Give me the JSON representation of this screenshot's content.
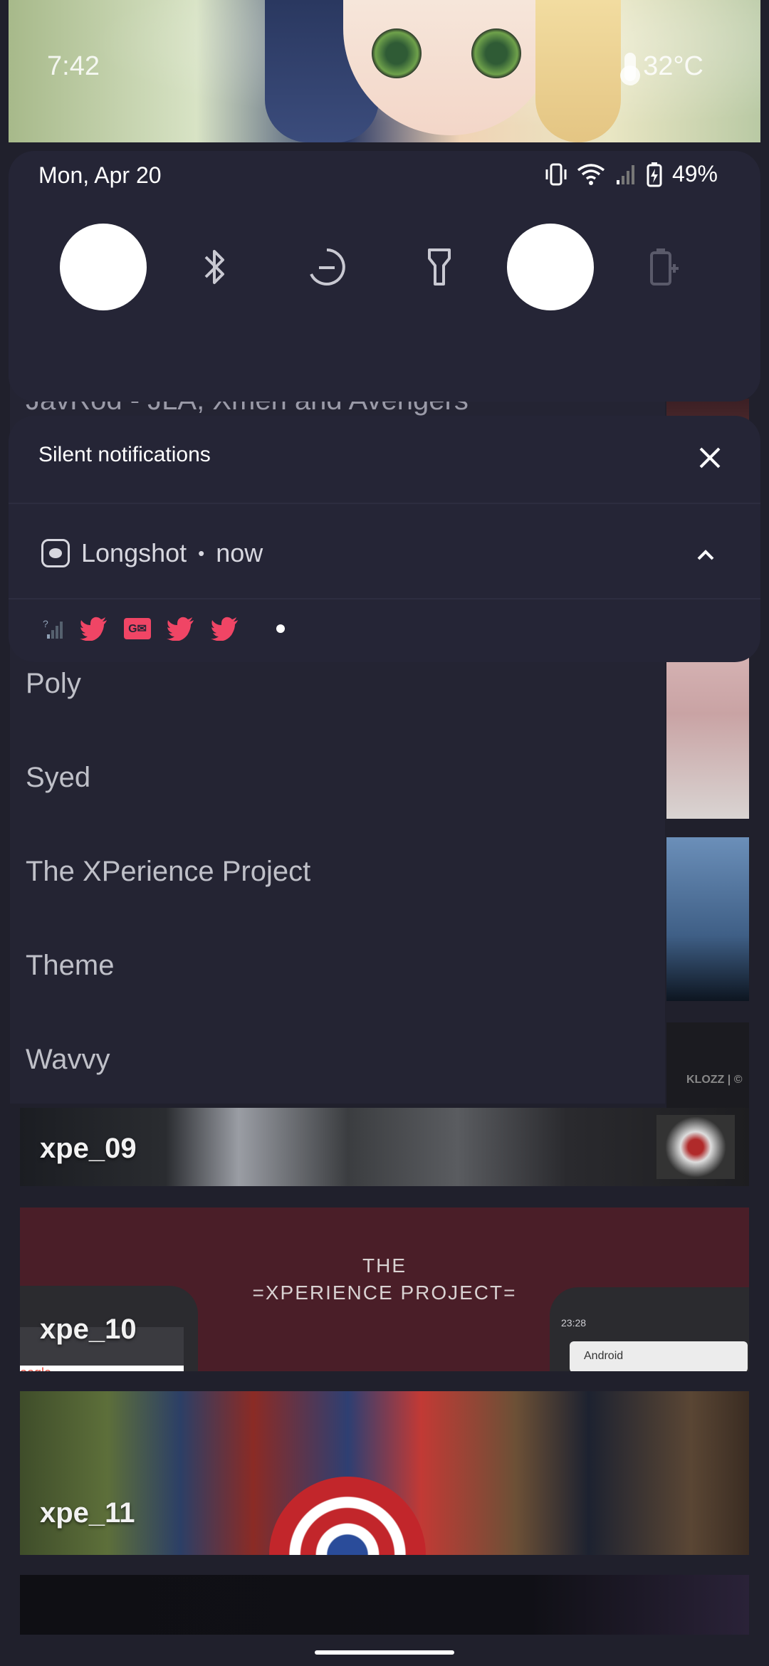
{
  "header": {
    "time": "7:42",
    "temperature": "32°C"
  },
  "quick_settings": {
    "date": "Mon, Apr 20",
    "battery": "49%",
    "tiles": [
      {
        "name": "tile-1",
        "state": "on"
      },
      {
        "name": "bluetooth",
        "state": "off"
      },
      {
        "name": "do-not-disturb",
        "state": "off"
      },
      {
        "name": "flashlight",
        "state": "off"
      },
      {
        "name": "tile-5",
        "state": "on"
      },
      {
        "name": "battery-saver",
        "state": "disabled"
      }
    ]
  },
  "notification": {
    "section_title": "Silent notifications",
    "app_name": "Longshot",
    "separator": "•",
    "time": "now",
    "icons": [
      "signal-unknown-icon",
      "twitter-icon",
      "gmail-icon",
      "twitter-icon",
      "twitter-icon",
      "more-dot-icon"
    ]
  },
  "background_list": {
    "partial_item": "JavRod - JLA, Xmen and Avengers",
    "items": [
      "Poly",
      "Syed",
      "The XPerience Project",
      "Theme",
      "Wavvy"
    ]
  },
  "banners": [
    {
      "label": "xpe_09",
      "art_text": "KLOZZ | ©"
    },
    {
      "label": "xpe_10",
      "art_text_line1": "THE",
      "art_text_line2": "=XPERIENCE PROJECT=",
      "phone_time": "23:28",
      "phone_label": "Android",
      "google_text": "oogle"
    },
    {
      "label": "xpe_11"
    }
  ],
  "colors": {
    "accent": "#f04565",
    "panel": "#252536",
    "background": "#20202c"
  }
}
